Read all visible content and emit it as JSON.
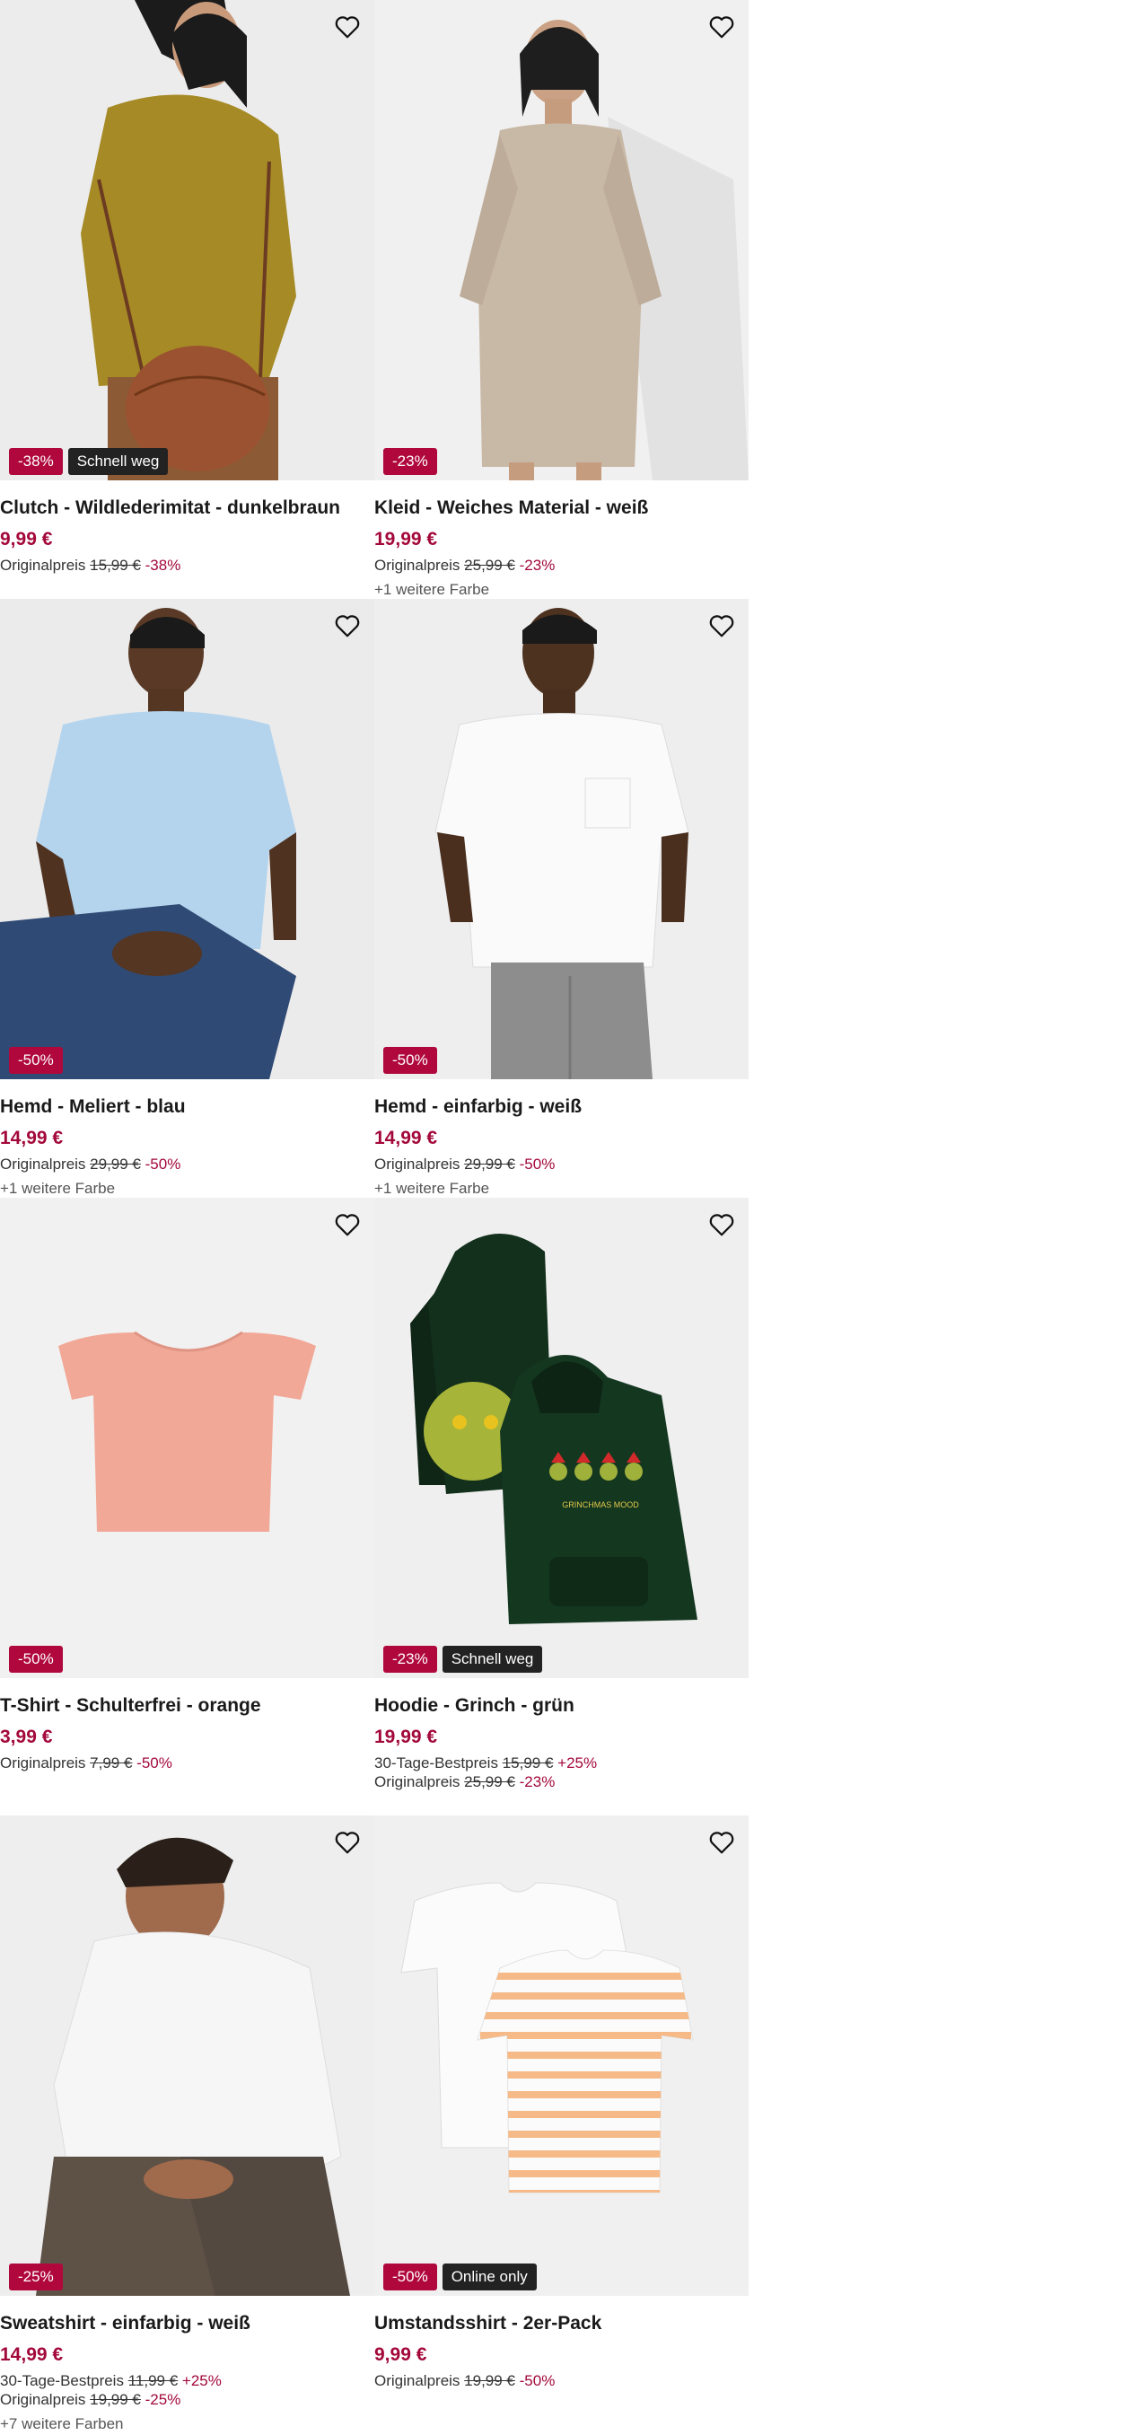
{
  "products": [
    {
      "title": "Clutch - Wildlederimitat - dunkelbraun",
      "price": "9,99 €",
      "badges": [
        {
          "text": "-38%",
          "style": "discount"
        },
        {
          "text": "Schnell weg",
          "style": "dark"
        }
      ],
      "ref_lines": [
        {
          "label": "Originalpreis",
          "old": "15,99 €",
          "pct": "-38%"
        }
      ],
      "colors": "",
      "image": "woman-clutch"
    },
    {
      "title": "Kleid - Weiches Material - weiß",
      "price": "19,99 €",
      "badges": [
        {
          "text": "-23%",
          "style": "discount"
        }
      ],
      "ref_lines": [
        {
          "label": "Originalpreis",
          "old": "25,99 €",
          "pct": "-23%"
        }
      ],
      "colors": "+1 weitere Farbe",
      "image": "woman-dress"
    },
    {
      "title": "Hemd - Meliert - blau",
      "price": "14,99 €",
      "badges": [
        {
          "text": "-50%",
          "style": "discount"
        }
      ],
      "ref_lines": [
        {
          "label": "Originalpreis",
          "old": "29,99 €",
          "pct": "-50%"
        }
      ],
      "colors": "+1 weitere Farbe",
      "image": "man-blue-shirt"
    },
    {
      "title": "Hemd - einfarbig - weiß",
      "price": "14,99 €",
      "badges": [
        {
          "text": "-50%",
          "style": "discount"
        }
      ],
      "ref_lines": [
        {
          "label": "Originalpreis",
          "old": "29,99 €",
          "pct": "-50%"
        }
      ],
      "colors": "+1 weitere Farbe",
      "image": "man-white-shirt"
    },
    {
      "title": "T-Shirt - Schulterfrei - orange",
      "price": "3,99 €",
      "badges": [
        {
          "text": "-50%",
          "style": "discount"
        }
      ],
      "ref_lines": [
        {
          "label": "Originalpreis",
          "old": "7,99 €",
          "pct": "-50%"
        }
      ],
      "colors": "",
      "image": "pink-tshirt"
    },
    {
      "title": "Hoodie - Grinch - grün",
      "price": "19,99 €",
      "badges": [
        {
          "text": "-23%",
          "style": "discount"
        },
        {
          "text": "Schnell weg",
          "style": "dark"
        }
      ],
      "ref_lines": [
        {
          "label": "30-Tage-Bestpreis",
          "old": "15,99 €",
          "pct": "+25%"
        },
        {
          "label": "Originalpreis",
          "old": "25,99 €",
          "pct": "-23%"
        }
      ],
      "colors": "",
      "image": "grinch-hoodie",
      "hoodie_print": "GRINCHMAS MOOD"
    },
    {
      "title": "Sweatshirt - einfarbig - weiß",
      "price": "14,99 €",
      "badges": [
        {
          "text": "-25%",
          "style": "discount"
        }
      ],
      "ref_lines": [
        {
          "label": "30-Tage-Bestpreis",
          "old": "11,99 €",
          "pct": "+25%"
        },
        {
          "label": "Originalpreis",
          "old": "19,99 €",
          "pct": "-25%"
        }
      ],
      "colors": "+7 weitere Farben",
      "image": "man-sweatshirt"
    },
    {
      "title": "Umstandsshirt - 2er-Pack",
      "price": "9,99 €",
      "badges": [
        {
          "text": "-50%",
          "style": "discount"
        },
        {
          "text": "Online only",
          "style": "dark"
        }
      ],
      "ref_lines": [
        {
          "label": "Originalpreis",
          "old": "19,99 €",
          "pct": "-50%"
        }
      ],
      "colors": "",
      "image": "maternity-shirts"
    }
  ],
  "colors": {
    "price": "#a3083a",
    "discount_badge": "#b0083c",
    "dark_badge": "#222222",
    "image_bg": "#f1f1f1"
  },
  "icons": {
    "wishlist": "heart-outline-icon"
  }
}
